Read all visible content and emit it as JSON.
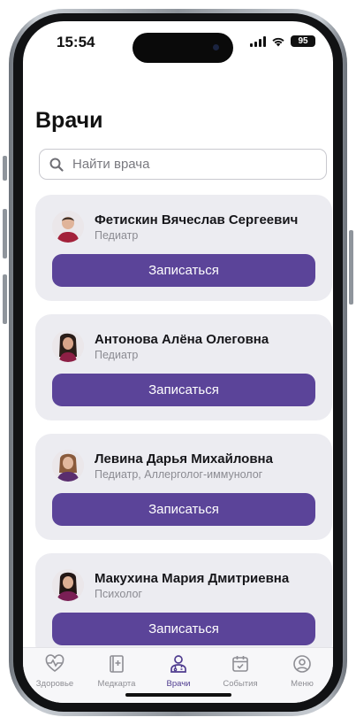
{
  "status": {
    "time": "15:54",
    "battery": "95"
  },
  "page": {
    "title": "Врачи"
  },
  "search": {
    "placeholder": "Найти врача"
  },
  "doctors": [
    {
      "name": "Фетискин Вячеслав Сергеевич",
      "specialty": "Педиатр",
      "button": "Записаться"
    },
    {
      "name": "Антонова Алёна Олеговна",
      "specialty": "Педиатр",
      "button": "Записаться"
    },
    {
      "name": "Левина Дарья Михайловна",
      "specialty": "Педиатр, Аллерголог-иммунолог",
      "button": "Записаться"
    },
    {
      "name": "Макухина Мария Дмитриевна",
      "specialty": "Психолог",
      "button": "Записаться"
    }
  ],
  "tabbar": {
    "items": [
      {
        "label": "Здоровье",
        "icon": "heart-pulse-icon"
      },
      {
        "label": "Медкарта",
        "icon": "medical-record-icon"
      },
      {
        "label": "Врачи",
        "icon": "doctor-icon",
        "active": true
      },
      {
        "label": "События",
        "icon": "calendar-check-icon"
      },
      {
        "label": "Меню",
        "icon": "profile-menu-icon"
      }
    ]
  },
  "colors": {
    "accent": "#5b4499",
    "card": "#ececf1",
    "active_tab": "#4f3c8f",
    "inactive_tab": "#8e8e94"
  }
}
